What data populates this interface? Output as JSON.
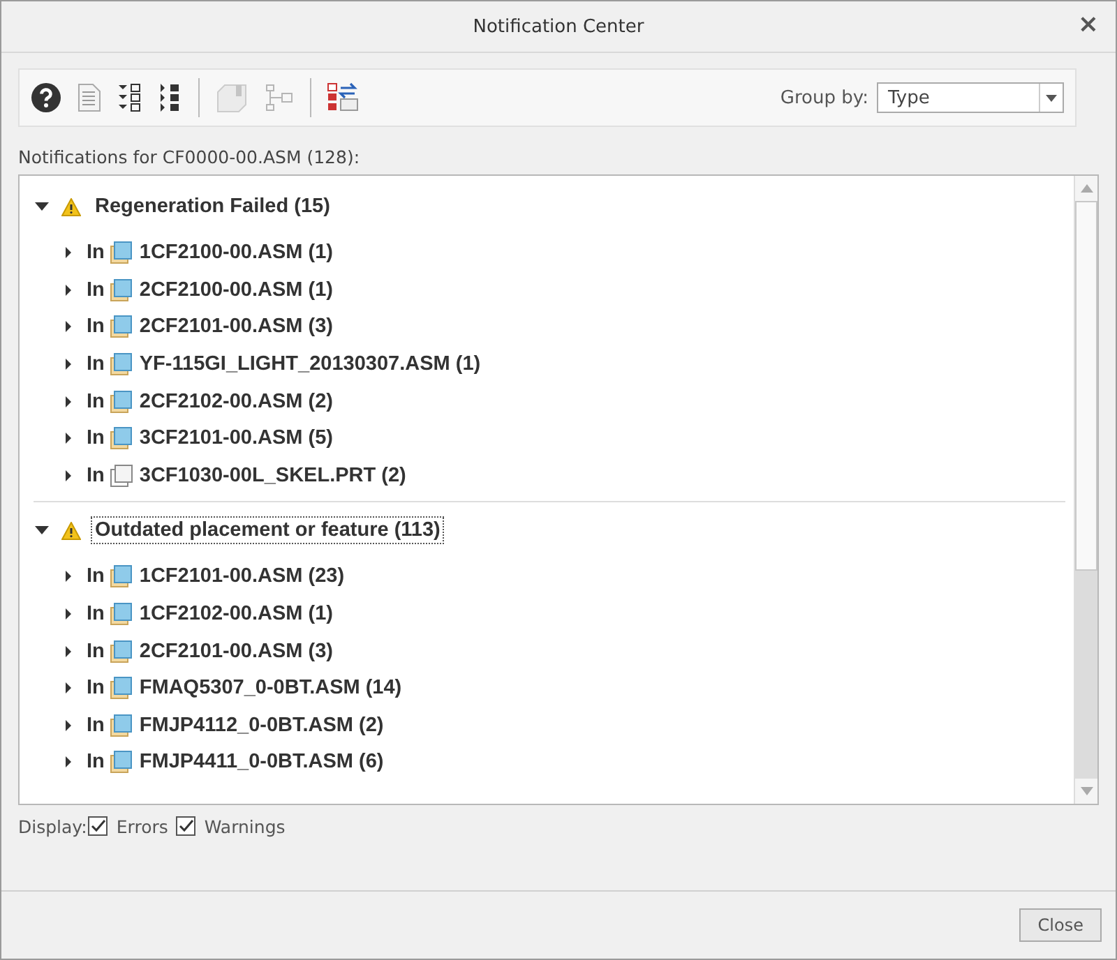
{
  "window": {
    "title": "Notification Center",
    "close": "×"
  },
  "toolbar": {
    "tools": [
      {
        "kind": "help",
        "disabled": false
      },
      {
        "kind": "list",
        "disabled": false
      },
      {
        "kind": "expand",
        "disabled": false
      },
      {
        "kind": "collapse",
        "disabled": false
      },
      {
        "kind": "sep"
      },
      {
        "kind": "block",
        "disabled": true
      },
      {
        "kind": "tree",
        "disabled": true
      },
      {
        "kind": "sep"
      },
      {
        "kind": "swap",
        "disabled": false
      }
    ],
    "group_by": {
      "label": "Group by:",
      "value": "Type"
    }
  },
  "summary": "Notifications for CF0000-00.ASM (128):",
  "groups": [
    {
      "title": "Regeneration Failed (15)",
      "expanded": true,
      "selected": false,
      "children": [
        {
          "prefix": "In",
          "name": "1CF2100-00.ASM (1)",
          "kind": "asm",
          "expanded": false
        },
        {
          "prefix": "In",
          "name": "2CF2100-00.ASM (1)",
          "kind": "asm",
          "expanded": false
        },
        {
          "prefix": "In",
          "name": "2CF2101-00.ASM (3)",
          "kind": "asm",
          "expanded": false
        },
        {
          "prefix": "In",
          "name": "YF-115GI_LIGHT_20130307.ASM (1)",
          "kind": "asm",
          "expanded": false
        },
        {
          "prefix": "In",
          "name": "2CF2102-00.ASM (2)",
          "kind": "asm",
          "expanded": false
        },
        {
          "prefix": "In",
          "name": "3CF2101-00.ASM (5)",
          "kind": "asm",
          "expanded": false
        },
        {
          "prefix": "In",
          "name": "3CF1030-00L_SKEL.PRT (2)",
          "kind": "prt",
          "expanded": false
        }
      ]
    },
    {
      "title": "Outdated placement or feature (113)",
      "expanded": true,
      "selected": true,
      "children": [
        {
          "prefix": "In",
          "name": "1CF2101-00.ASM (23)",
          "kind": "asm",
          "expanded": false
        },
        {
          "prefix": "In",
          "name": "1CF2102-00.ASM (1)",
          "kind": "asm",
          "expanded": false
        },
        {
          "prefix": "In",
          "name": "2CF2101-00.ASM (3)",
          "kind": "asm",
          "expanded": false
        },
        {
          "prefix": "In",
          "name": "FMAQ5307_0-0BT.ASM (14)",
          "kind": "asm",
          "expanded": false
        },
        {
          "prefix": "In",
          "name": "FMJP4112_0-0BT.ASM (2)",
          "kind": "asm",
          "expanded": false
        },
        {
          "prefix": "In",
          "name": "FMJP4411_0-0BT.ASM (6)",
          "kind": "asm",
          "expanded": false
        }
      ]
    }
  ],
  "display": {
    "label": "Display:",
    "options": [
      {
        "label": "Errors",
        "checked": true
      },
      {
        "label": "Warnings",
        "checked": true
      }
    ]
  },
  "buttons": [
    {
      "label": "Close"
    }
  ]
}
